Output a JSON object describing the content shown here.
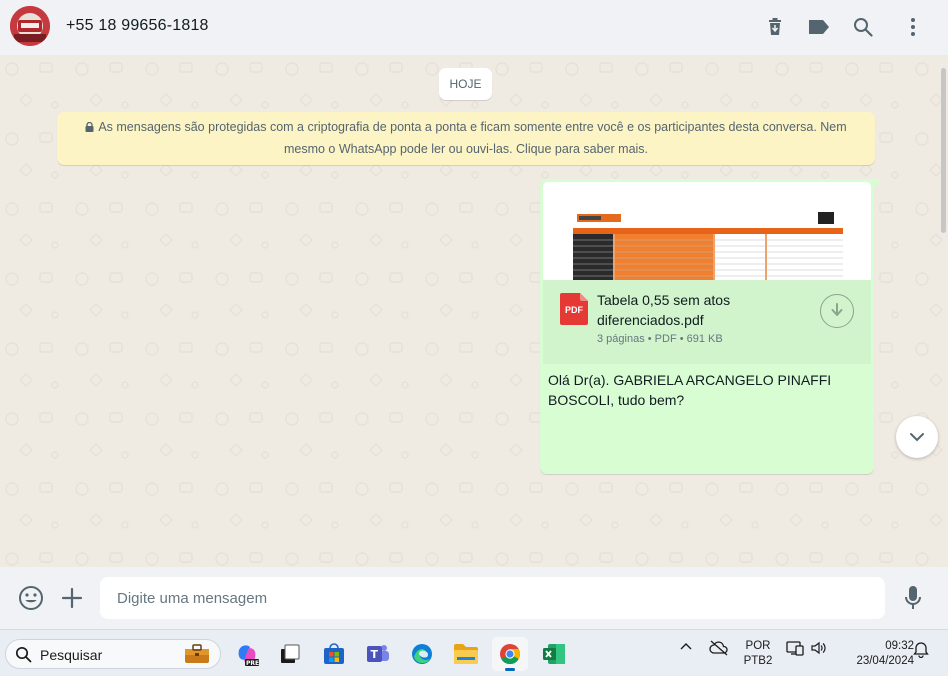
{
  "header": {
    "contact_name": "+55 18 99656-1818",
    "icons": [
      "delete-icon",
      "label-icon",
      "search-icon",
      "menu-icon"
    ]
  },
  "chat": {
    "date_chip": "HOJE",
    "encryption_notice": "As mensagens são protegidas com a criptografia de ponta a ponta e ficam somente entre você e os participantes desta conversa. Nem mesmo o WhatsApp pode ler ou ouvi-las. Clique para saber mais.",
    "message": {
      "document_name": "Tabela 0,55 sem atos diferenciados.pdf",
      "document_meta": "3 páginas • PDF • 691 KB",
      "pdf_badge": "PDF",
      "text": "Olá Dr(a). GABRIELA ARCANGELO PINAFFI BOSCOLI, tudo bem?"
    }
  },
  "composer": {
    "placeholder": "Digite uma mensagem"
  },
  "taskbar": {
    "search_label": "Pesquisar",
    "language_top": "POR",
    "language_bottom": "PTB2",
    "time": "09:32",
    "date": "23/04/2024"
  },
  "colors": {
    "header_bg": "#f0f2f5",
    "chat_bg": "#efeae2",
    "outgoing_bubble": "#d9fdd3",
    "encryption_bg": "#fdf4c5",
    "pdf_red": "#e53935"
  }
}
